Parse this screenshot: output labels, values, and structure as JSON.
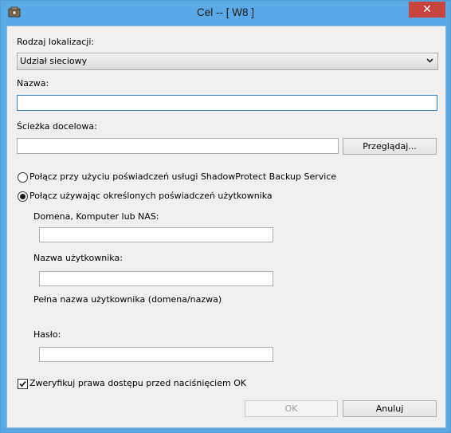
{
  "window": {
    "title": "Cel -- [ W8 ]",
    "close_label": "✕"
  },
  "location_type": {
    "label": "Rodzaj lokalizacji:",
    "value": "Udział sieciowy"
  },
  "name": {
    "label": "Nazwa:",
    "value": ""
  },
  "target_path": {
    "label": "Ścieżka docelowa:",
    "value": "",
    "browse_label": "Przeglądaj..."
  },
  "credentials": {
    "option_service": "Połącz przy użyciu poświadczeń usługi ShadowProtect Backup Service",
    "option_user": "Połącz używając określonych poświadczeń użytkownika",
    "selected": "option_user"
  },
  "domain": {
    "label": "Domena, Komputer lub NAS:",
    "value": ""
  },
  "username": {
    "label": "Nazwa użytkownika:",
    "value": ""
  },
  "fullname": {
    "label": "Pełna nazwa użytkownika (domena/nazwa)"
  },
  "password": {
    "label": "Hasło:",
    "value": ""
  },
  "verify": {
    "label": "Zweryfikuj prawa dostępu przed naciśnięciem OK",
    "checked": true
  },
  "buttons": {
    "ok": "OK",
    "cancel": "Anuluj"
  }
}
